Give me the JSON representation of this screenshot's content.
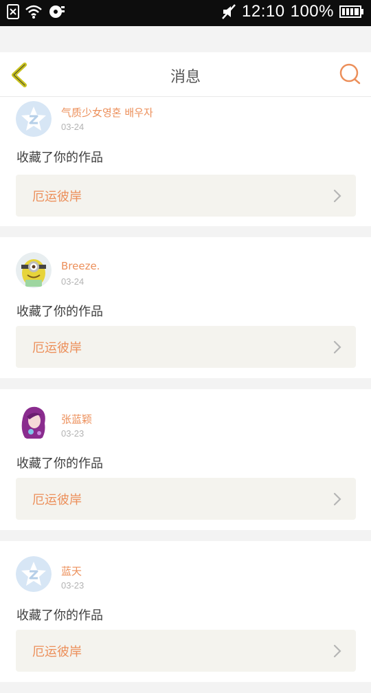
{
  "status_bar": {
    "time": "12:10",
    "battery": "100%",
    "icons": [
      "sim-off-icon",
      "wifi-icon",
      "sync-icon",
      "mute-icon",
      "battery-icon"
    ]
  },
  "header": {
    "title": "消息",
    "back_icon": "chevron-left-icon",
    "search_icon": "search-icon"
  },
  "colors": {
    "accent": "#ec8f5a",
    "back_accent": "#c9c21e",
    "card_bg": "#ffffff",
    "work_bg": "#f4f3ee",
    "page_bg": "#f3f3f3"
  },
  "messages": [
    {
      "name": "气质少女영혼 배우자",
      "date": "03-24",
      "action": "收藏了你的作品",
      "work": "厄运彼岸",
      "avatar": "default-avatar-icon"
    },
    {
      "name": "Breeze.",
      "date": "03-24",
      "action": "收藏了你的作品",
      "work": "厄运彼岸",
      "avatar": "minion-avatar"
    },
    {
      "name": "张蓝颖",
      "date": "03-23",
      "action": "收藏了你的作品",
      "work": "厄运彼岸",
      "avatar": "purple-hair-avatar"
    },
    {
      "name": "蓝天",
      "date": "03-23",
      "action": "收藏了你的作品",
      "work": "厄运彼岸",
      "avatar": "default-avatar-icon"
    }
  ]
}
